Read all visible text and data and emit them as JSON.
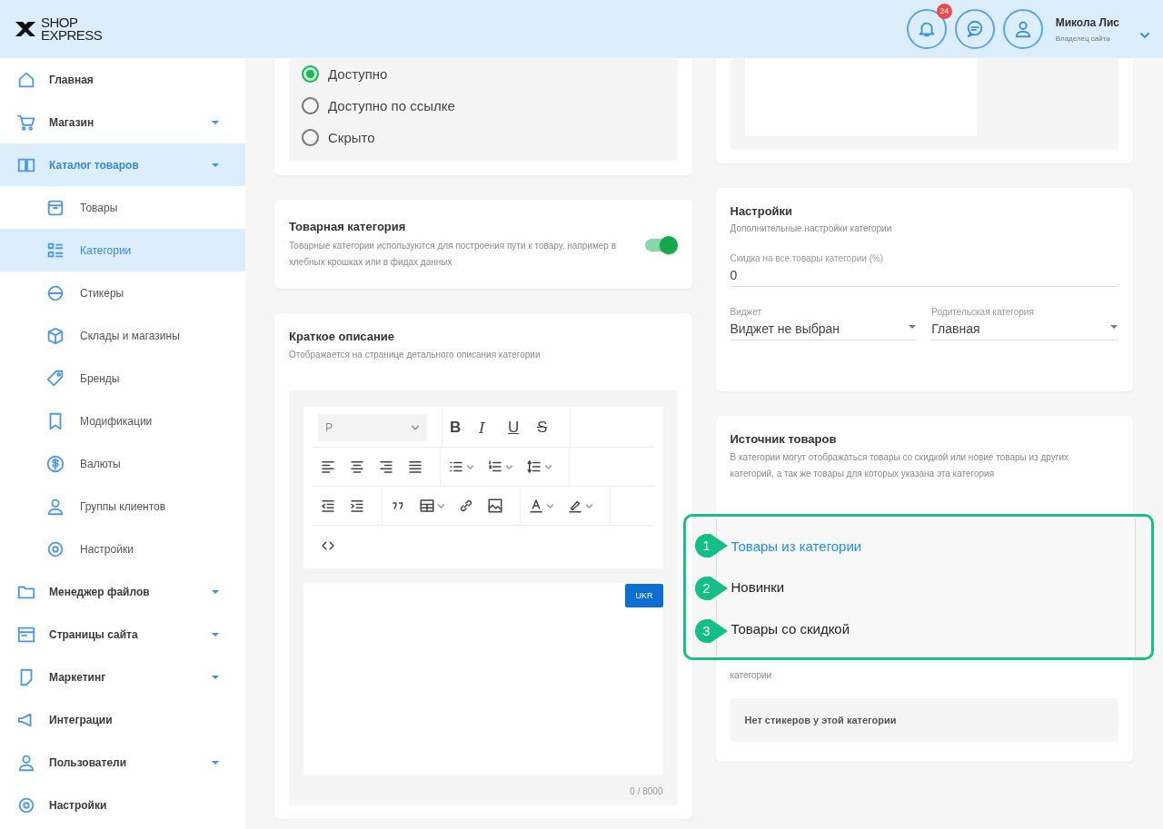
{
  "header": {
    "logo": {
      "line1": "SHOP",
      "line2": "EXPRESS"
    },
    "notifications": {
      "count": "24"
    },
    "user": {
      "name": "Микола Лис",
      "role": "Владелец сайта"
    }
  },
  "sidebar": {
    "items": [
      {
        "label": "Главная",
        "selected": false,
        "expandable": false
      },
      {
        "label": "Магазин",
        "selected": false,
        "expandable": true
      },
      {
        "label": "Каталог товаров",
        "selected": true,
        "expandable": true,
        "children": [
          {
            "label": "Товары",
            "selected": false
          },
          {
            "label": "Категории",
            "selected": true
          },
          {
            "label": "Стикеры",
            "selected": false
          },
          {
            "label": "Склады и магазины",
            "selected": false
          },
          {
            "label": "Бренды",
            "selected": false
          },
          {
            "label": "Модификации",
            "selected": false
          },
          {
            "label": "Валюты",
            "selected": false
          },
          {
            "label": "Группы клиентов",
            "selected": false
          },
          {
            "label": "Настройки",
            "selected": false
          }
        ]
      },
      {
        "label": "Менеджер файлов",
        "selected": false,
        "expandable": true
      },
      {
        "label": "Страницы сайта",
        "selected": false,
        "expandable": true
      },
      {
        "label": "Маркетинг",
        "selected": false,
        "expandable": true
      },
      {
        "label": "Интеграции",
        "selected": false,
        "expandable": false
      },
      {
        "label": "Пользователи",
        "selected": false,
        "expandable": true
      },
      {
        "label": "Настройки",
        "selected": false,
        "expandable": false
      }
    ]
  },
  "visibility": {
    "options": [
      {
        "label": "Доступно",
        "selected": true
      },
      {
        "label": "Доступно по ссылке",
        "selected": false
      },
      {
        "label": "Скрыто",
        "selected": false
      }
    ]
  },
  "category_toggle": {
    "title": "Товарная категория",
    "description": "Товарные категории используются для построения пути к товару, например в хлебных крошках или в фидах данных",
    "on": true
  },
  "short_description": {
    "title": "Краткое описание",
    "description": "Отображается на странице детального описания категории",
    "editor": {
      "toolbar": [
        [
          [
            {
              "kind": "format-select",
              "label": "P"
            }
          ],
          [
            {
              "kind": "bold",
              "label": "B"
            },
            {
              "kind": "italic",
              "label": "I"
            },
            {
              "kind": "underline",
              "label": "U"
            },
            {
              "kind": "strike",
              "label": "S"
            }
          ]
        ],
        [
          [
            {
              "kind": "align-left"
            },
            {
              "kind": "align-center"
            },
            {
              "kind": "align-right"
            },
            {
              "kind": "justify"
            }
          ],
          [
            {
              "kind": "bullets",
              "dropdown": true
            },
            {
              "kind": "numbers",
              "dropdown": true
            },
            {
              "kind": "line-height",
              "dropdown": true
            }
          ]
        ],
        [
          [
            {
              "kind": "outdent"
            },
            {
              "kind": "indent"
            }
          ],
          [
            {
              "kind": "quote"
            },
            {
              "kind": "table",
              "dropdown": true
            },
            {
              "kind": "link"
            },
            {
              "kind": "image"
            }
          ],
          [
            {
              "kind": "font-color",
              "dropdown": true
            },
            {
              "kind": "highlight",
              "dropdown": true
            }
          ]
        ],
        [
          [
            {
              "kind": "code"
            }
          ]
        ]
      ],
      "language_button": "UKR",
      "counter": "0 / 8000"
    }
  },
  "settings": {
    "title": "Настройки",
    "subtitle": "Дополнительные настройки категории",
    "discount": {
      "label": "Скидка на все товары категории (%)",
      "value": "0"
    },
    "widget": {
      "label": "Виджет",
      "value": "Виджет не выбран"
    },
    "parent": {
      "label": "Родительская категория",
      "value": "Главная"
    }
  },
  "product_source": {
    "title": "Источник товаров",
    "description": "В категории могут отображаться товары со скидкой или новие товары из других категорий, а так же товары для которых указана эта категория",
    "menu": {
      "options": [
        {
          "label": "Товары из категории",
          "selected": true,
          "marker": "1"
        },
        {
          "label": "Новинки",
          "selected": false,
          "marker": "2"
        },
        {
          "label": "Товары со скидкой",
          "selected": false,
          "marker": "3"
        }
      ]
    }
  },
  "stickers": {
    "description": "категории",
    "empty_text": "Нет стикеров у этой категории"
  }
}
